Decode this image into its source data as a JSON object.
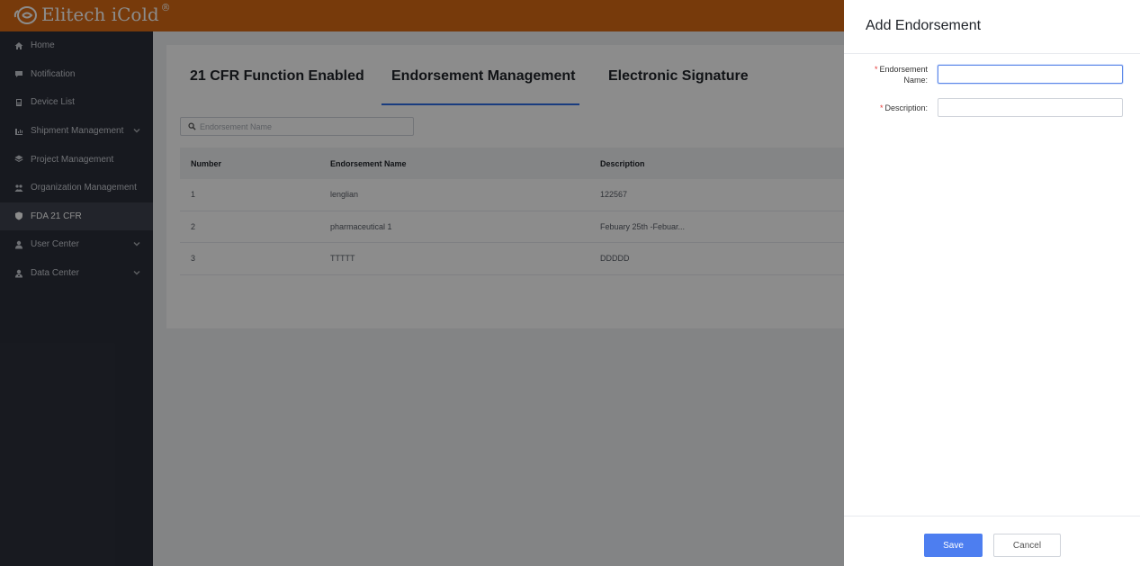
{
  "header": {
    "logo_text": "Elitech iCold",
    "logo_reg": "®"
  },
  "sidebar": {
    "items": [
      {
        "label": "Home",
        "icon": "home-icon"
      },
      {
        "label": "Notification",
        "icon": "notification-icon"
      },
      {
        "label": "Device List",
        "icon": "device-icon"
      },
      {
        "label": "Shipment Management",
        "icon": "shipment-icon",
        "expandable": true
      },
      {
        "label": "Project Management",
        "icon": "project-icon"
      },
      {
        "label": "Organization Management",
        "icon": "organization-icon"
      },
      {
        "label": "FDA 21 CFR",
        "icon": "shield-icon",
        "active": true
      },
      {
        "label": "User Center",
        "icon": "user-icon",
        "expandable": true
      },
      {
        "label": "Data Center",
        "icon": "data-icon",
        "expandable": true
      }
    ]
  },
  "main": {
    "tabs": [
      {
        "label": "21 CFR Function Enabled"
      },
      {
        "label": "Endorsement Management",
        "active": true
      },
      {
        "label": "Electronic Signature"
      }
    ],
    "search": {
      "placeholder": "Endorsement Name"
    },
    "table": {
      "columns": [
        "Number",
        "Endorsement Name",
        "Description"
      ],
      "rows": [
        [
          "1",
          "lenglian",
          "122567"
        ],
        [
          "2",
          "pharmaceutical 1",
          "Febuary 25th -Febuar..."
        ],
        [
          "3",
          "TTTTT",
          "DDDDD"
        ]
      ]
    }
  },
  "drawer": {
    "title": "Add Endorsement",
    "fields": {
      "name_label": "Endorsement Name:",
      "name_label_line1": "Endorsement",
      "name_label_line2": "Name:",
      "name_value": "",
      "description_label": "Description:",
      "description_value": ""
    },
    "save_label": "Save",
    "cancel_label": "Cancel"
  },
  "colors": {
    "header": "#d96b14",
    "sidebar": "#2b2f3a",
    "accent": "#4d7ef0",
    "required": "#e53935"
  }
}
